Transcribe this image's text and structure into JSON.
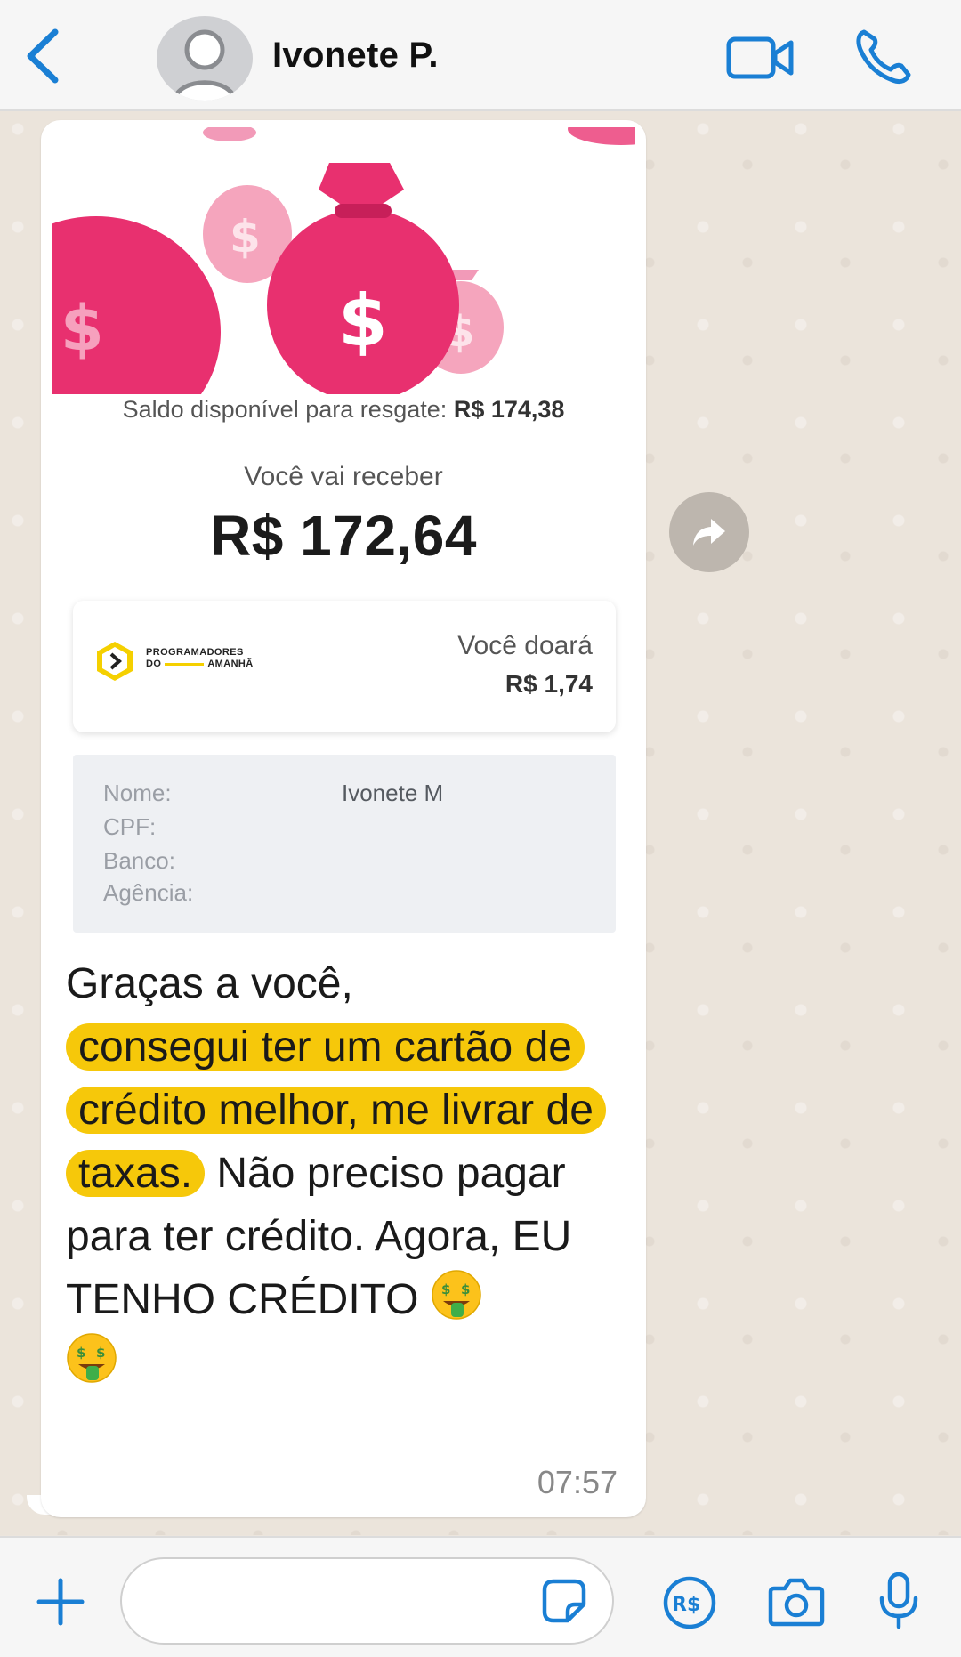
{
  "header": {
    "contact_name": "Ivonete P."
  },
  "icons": {
    "back": "chevron-left-icon",
    "avatar": "person-silhouette",
    "video": "video-camera-icon",
    "call": "phone-icon",
    "forward": "share-arrow-icon",
    "plus": "plus-icon",
    "sticker": "sticker-icon",
    "pix": "currency-R$-icon",
    "camera": "camera-icon",
    "mic": "microphone-icon"
  },
  "colors": {
    "accent": "#1a7fd4",
    "highlight": "#f6c80a",
    "hero_pink": "#e8306f"
  },
  "message": {
    "screenshot": {
      "saldo_label": "Saldo disponível para resgate:",
      "saldo_value": "R$ 174,38",
      "receber_label": "Você vai receber",
      "receber_value": "R$ 172,64",
      "donation": {
        "org_line1": "PROGRAMADORES",
        "org_line2_a": "DO",
        "org_line2_b": "AMANHÃ",
        "label": "Você doará",
        "value": "R$ 1,74"
      },
      "details": {
        "nome_label": "Nome:",
        "nome_value": "Ivonete M",
        "cpf_label": "CPF:",
        "banco_label": "Banco:",
        "agencia_label": "Agência:"
      }
    },
    "text": {
      "line1": "Graças a você,",
      "highlight": "consegui ter um cartão de crédito melhor, me livrar de taxas.",
      "rest": "Não preciso pagar para ter crédito. Agora, EU TENHO CRÉDITO"
    },
    "time": "07:57"
  },
  "input": {
    "placeholder": ""
  }
}
